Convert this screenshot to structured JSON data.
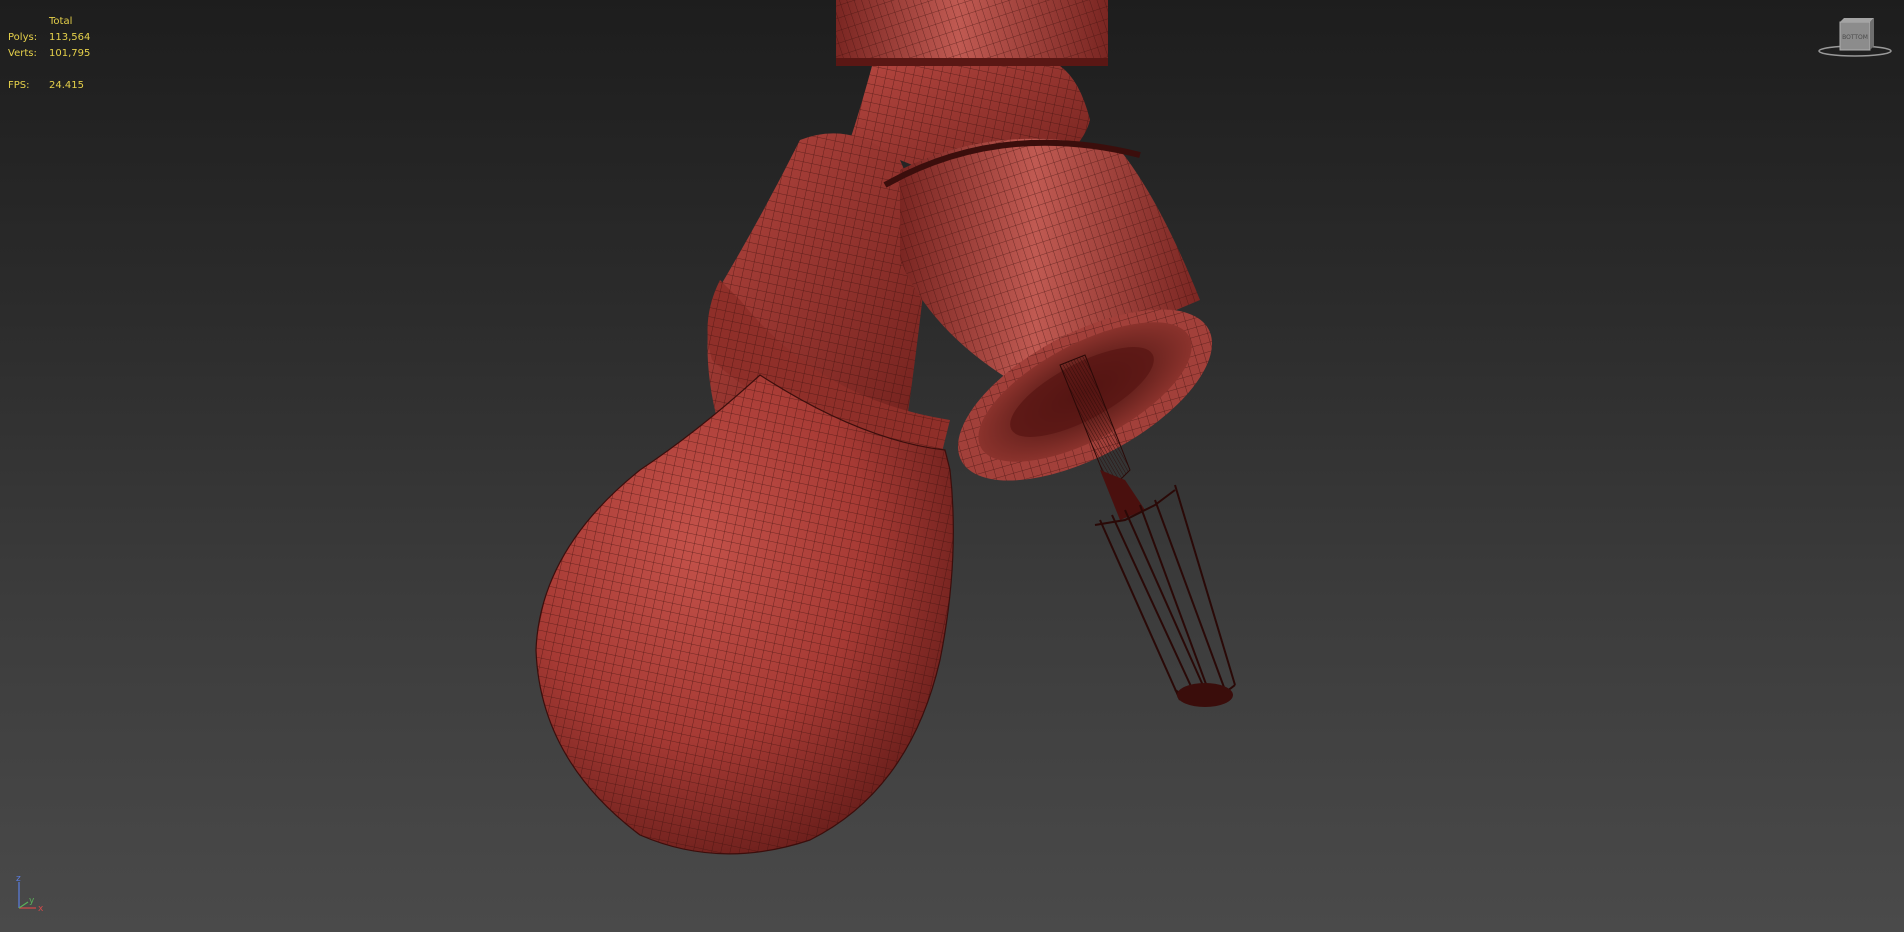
{
  "viewport": {
    "stats": {
      "header": "Total",
      "polys_label": "Polys:",
      "polys_value": "113,564",
      "verts_label": "Verts:",
      "verts_value": "101,795",
      "fps_label": "FPS:",
      "fps_value": "24.415"
    },
    "viewcube": {
      "face_label": "BOTTOM"
    },
    "axis": {
      "z": "z",
      "x": "x",
      "y": "y"
    },
    "colors": {
      "mesh_fill": "#a63a34",
      "mesh_wire": "#3b0e0c",
      "stats_text": "#e6d14a",
      "background_top": "#1d1d1d",
      "background_bottom": "#4a4a4a"
    }
  }
}
